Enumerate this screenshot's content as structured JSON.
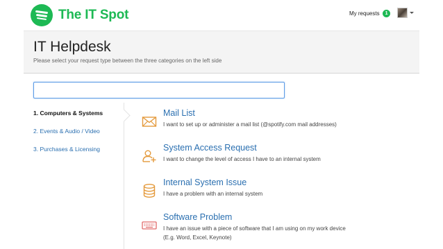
{
  "header": {
    "brand": "The IT Spot",
    "my_requests_label": "My requests",
    "my_requests_count": "1"
  },
  "page": {
    "title": "IT Helpdesk",
    "subtitle": "Please select your request type between the three categories on the left side"
  },
  "search": {
    "value": "",
    "placeholder": ""
  },
  "nav": {
    "items": [
      {
        "label": "1. Computers & Systems"
      },
      {
        "label": "2. Events & Audio / Video"
      },
      {
        "label": "3. Purchases & Licensing"
      }
    ]
  },
  "categories": [
    {
      "title": "Mail List",
      "description": "I want to set up or administer a mail list (@spotify.com mail addresses)",
      "icon": "envelope-icon"
    },
    {
      "title": "System Access Request",
      "description": "I want to change the level of access I have to an internal system",
      "icon": "user-add-icon"
    },
    {
      "title": "Internal System Issue",
      "description": "I have a problem with an internal system",
      "icon": "database-icon"
    },
    {
      "title": "Software Problem",
      "description": "I have an issue with a piece of software that I am using on my work device",
      "description2": "(E.g. Word, Excel, Keynote)",
      "icon": "keyboard-icon"
    }
  ],
  "colors": {
    "brand": "#1db954",
    "link": "#2a6fb0",
    "icon_accent": "#e49a3c",
    "keyboard_icon": "#e06a6a"
  }
}
